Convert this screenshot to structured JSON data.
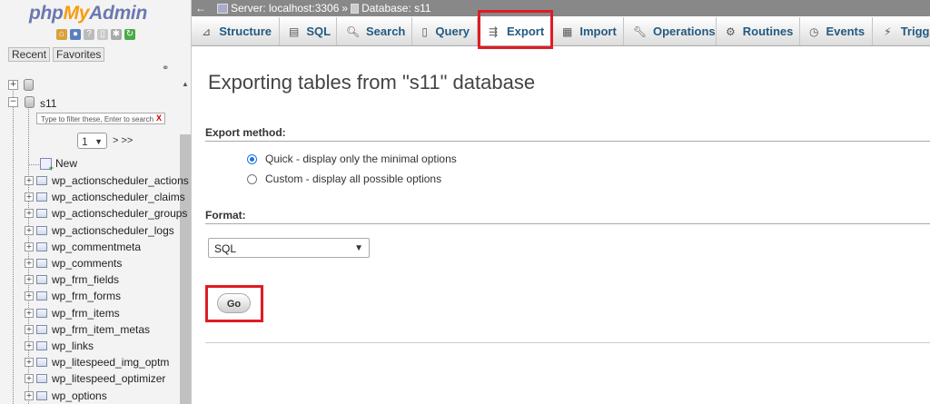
{
  "nav": {
    "logo": {
      "part1": "php",
      "part2": "My",
      "part3": "Admin"
    },
    "tabs": [
      "Recent",
      "Favorites"
    ],
    "database": "s11",
    "filter_placeholder": "Type to filter these, Enter to search",
    "filter_clear": "X",
    "page_number": "1",
    "page_next": "> >>",
    "new_label": "New",
    "tables": [
      "wp_actionscheduler_actions",
      "wp_actionscheduler_claims",
      "wp_actionscheduler_groups",
      "wp_actionscheduler_logs",
      "wp_commentmeta",
      "wp_comments",
      "wp_frm_fields",
      "wp_frm_forms",
      "wp_frm_items",
      "wp_frm_item_metas",
      "wp_links",
      "wp_litespeed_img_optm",
      "wp_litespeed_optimizer",
      "wp_options"
    ]
  },
  "topbar": {
    "server": "Server: localhost:3306",
    "separator": "»",
    "database": "Database: s11"
  },
  "menu": {
    "structure": "Structure",
    "sql": "SQL",
    "search": "Search",
    "query": "Query",
    "export": "Export",
    "import": "Import",
    "operations": "Operations",
    "routines": "Routines",
    "events": "Events",
    "triggers": "Triggers"
  },
  "main": {
    "title": "Exporting tables from \"s11\" database",
    "export_method_label": "Export method:",
    "quick_option": "Quick - display only the minimal options",
    "custom_option": "Custom - display all possible options",
    "format_label": "Format:",
    "format_value": "SQL",
    "go_label": "Go"
  },
  "colors": {
    "highlight": "#e01b24",
    "link": "#235a81",
    "topbar": "#888888"
  }
}
